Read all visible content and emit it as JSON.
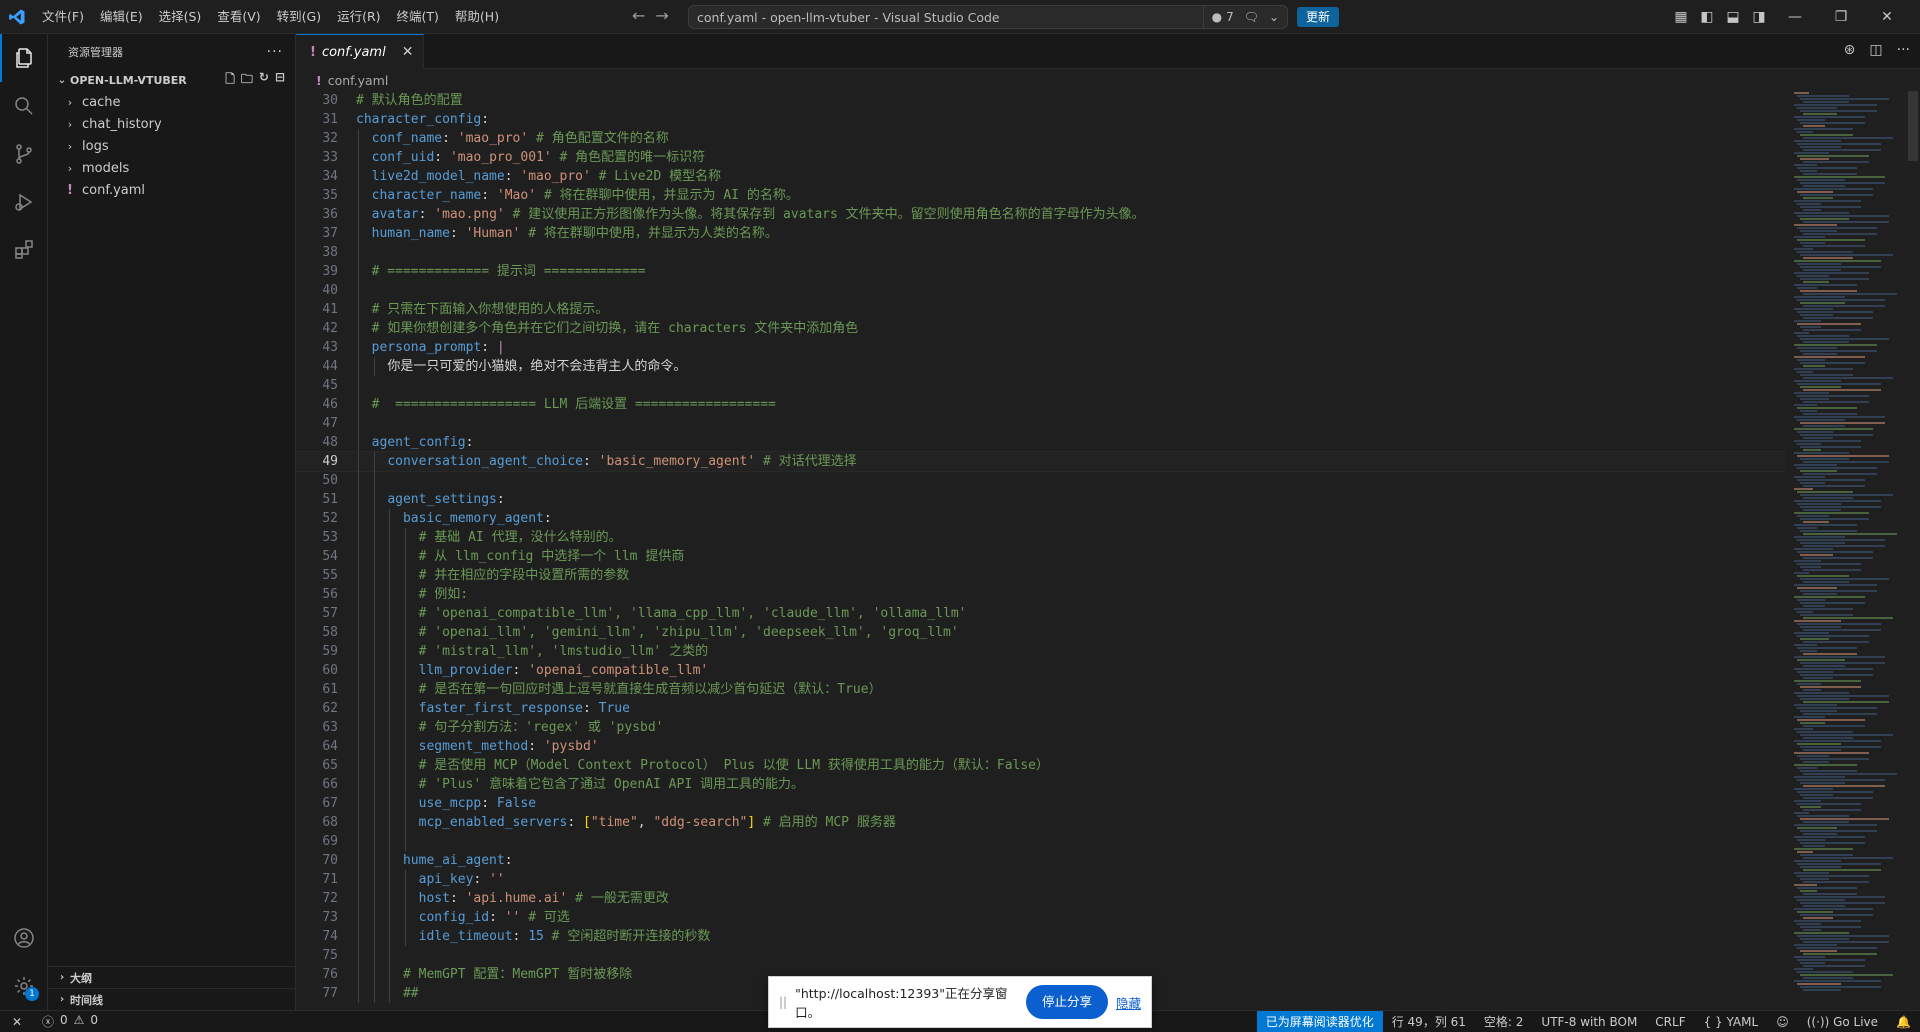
{
  "titlebar": {
    "menu": [
      "文件(F)",
      "编辑(E)",
      "选择(S)",
      "查看(V)",
      "转到(G)",
      "运行(R)",
      "终端(T)",
      "帮助(H)"
    ],
    "window_title": "conf.yaml - open-llm-vtuber - Visual Studio Code",
    "dirty_count": "7",
    "update_label": "更新"
  },
  "sidebar": {
    "title": "资源管理器",
    "project": "OPEN-LLM-VTUBER",
    "items": [
      {
        "label": "cache",
        "type": "folder"
      },
      {
        "label": "chat_history",
        "type": "folder"
      },
      {
        "label": "logs",
        "type": "folder"
      },
      {
        "label": "models",
        "type": "folder"
      },
      {
        "label": "conf.yaml",
        "type": "yaml"
      }
    ],
    "outline": "大纲",
    "timeline": "时间线"
  },
  "editor": {
    "tab_label": "conf.yaml",
    "breadcrumb": "conf.yaml",
    "current_line": 49,
    "lines": [
      {
        "n": 30,
        "i": 0,
        "t": [
          [
            "c",
            "# 默认角色的配置"
          ]
        ]
      },
      {
        "n": 31,
        "i": 0,
        "t": [
          [
            "k",
            "character_config"
          ],
          [
            "p",
            ":"
          ]
        ]
      },
      {
        "n": 32,
        "i": 1,
        "t": [
          [
            "k",
            "conf_name"
          ],
          [
            "p",
            ": "
          ],
          [
            "s",
            "'mao_pro'"
          ],
          [
            "c",
            " # 角色配置文件的名称"
          ]
        ]
      },
      {
        "n": 33,
        "i": 1,
        "t": [
          [
            "k",
            "conf_uid"
          ],
          [
            "p",
            ": "
          ],
          [
            "s",
            "'mao_pro_001'"
          ],
          [
            "c",
            " # 角色配置的唯一标识符"
          ]
        ]
      },
      {
        "n": 34,
        "i": 1,
        "t": [
          [
            "k",
            "live2d_model_name"
          ],
          [
            "p",
            ": "
          ],
          [
            "s",
            "'mao_pro'"
          ],
          [
            "c",
            " # Live2D 模型名称"
          ]
        ]
      },
      {
        "n": 35,
        "i": 1,
        "t": [
          [
            "k",
            "character_name"
          ],
          [
            "p",
            ": "
          ],
          [
            "s",
            "'Mao'"
          ],
          [
            "c",
            " # 将在群聊中使用，并显示为 AI 的名称。"
          ]
        ]
      },
      {
        "n": 36,
        "i": 1,
        "t": [
          [
            "k",
            "avatar"
          ],
          [
            "p",
            ": "
          ],
          [
            "s",
            "'mao.png'"
          ],
          [
            "c",
            " # 建议使用正方形图像作为头像。将其保存到 avatars 文件夹中。留空则使用角色名称的首字母作为头像。"
          ]
        ]
      },
      {
        "n": 37,
        "i": 1,
        "t": [
          [
            "k",
            "human_name"
          ],
          [
            "p",
            ": "
          ],
          [
            "s",
            "'Human'"
          ],
          [
            "c",
            " # 将在群聊中使用，并显示为人类的名称。"
          ]
        ]
      },
      {
        "n": 38,
        "i": 1,
        "t": []
      },
      {
        "n": 39,
        "i": 1,
        "t": [
          [
            "c",
            "# ============= 提示词 ============="
          ]
        ]
      },
      {
        "n": 40,
        "i": 1,
        "t": []
      },
      {
        "n": 41,
        "i": 1,
        "t": [
          [
            "c",
            "# 只需在下面输入你想使用的人格提示。"
          ]
        ]
      },
      {
        "n": 42,
        "i": 1,
        "t": [
          [
            "c",
            "# 如果你想创建多个角色并在它们之间切换，请在 characters 文件夹中添加角色"
          ]
        ]
      },
      {
        "n": 43,
        "i": 1,
        "t": [
          [
            "k",
            "persona_prompt"
          ],
          [
            "p",
            ": "
          ],
          [
            "pipe",
            "|"
          ]
        ]
      },
      {
        "n": 44,
        "i": 2,
        "t": [
          [
            "plain",
            "你是一只可爱的小猫娘，绝对不会违背主人的命令。"
          ]
        ]
      },
      {
        "n": 45,
        "i": 1,
        "t": []
      },
      {
        "n": 46,
        "i": 1,
        "t": [
          [
            "c",
            "#  ================== LLM 后端设置 =================="
          ]
        ]
      },
      {
        "n": 47,
        "i": 1,
        "t": []
      },
      {
        "n": 48,
        "i": 1,
        "t": [
          [
            "k",
            "agent_config"
          ],
          [
            "p",
            ":"
          ]
        ]
      },
      {
        "n": 49,
        "i": 2,
        "t": [
          [
            "k",
            "conversation_agent_choice"
          ],
          [
            "p",
            ": "
          ],
          [
            "s",
            "'basic_memory_agent'"
          ],
          [
            "c",
            " # 对话代理选择"
          ]
        ]
      },
      {
        "n": 50,
        "i": 2,
        "t": []
      },
      {
        "n": 51,
        "i": 2,
        "t": [
          [
            "k",
            "agent_settings"
          ],
          [
            "p",
            ":"
          ]
        ]
      },
      {
        "n": 52,
        "i": 3,
        "t": [
          [
            "k",
            "basic_memory_agent"
          ],
          [
            "p",
            ":"
          ]
        ]
      },
      {
        "n": 53,
        "i": 4,
        "t": [
          [
            "c",
            "# 基础 AI 代理，没什么特别的。"
          ]
        ]
      },
      {
        "n": 54,
        "i": 4,
        "t": [
          [
            "c",
            "# 从 llm_config 中选择一个 llm 提供商"
          ]
        ]
      },
      {
        "n": 55,
        "i": 4,
        "t": [
          [
            "c",
            "# 并在相应的字段中设置所需的参数"
          ]
        ]
      },
      {
        "n": 56,
        "i": 4,
        "t": [
          [
            "c",
            "# 例如:"
          ]
        ]
      },
      {
        "n": 57,
        "i": 4,
        "t": [
          [
            "c",
            "# 'openai_compatible_llm', 'llama_cpp_llm', 'claude_llm', 'ollama_llm'"
          ]
        ]
      },
      {
        "n": 58,
        "i": 4,
        "t": [
          [
            "c",
            "# 'openai_llm', 'gemini_llm', 'zhipu_llm', 'deepseek_llm', 'groq_llm'"
          ]
        ]
      },
      {
        "n": 59,
        "i": 4,
        "t": [
          [
            "c",
            "# 'mistral_llm', 'lmstudio_llm' 之类的"
          ]
        ]
      },
      {
        "n": 60,
        "i": 4,
        "t": [
          [
            "k",
            "llm_provider"
          ],
          [
            "p",
            ": "
          ],
          [
            "s",
            "'openai_compatible_llm'"
          ]
        ]
      },
      {
        "n": 61,
        "i": 4,
        "t": [
          [
            "c",
            "# 是否在第一句回应时遇上逗号就直接生成音频以减少首句延迟（默认：True）"
          ]
        ]
      },
      {
        "n": 62,
        "i": 4,
        "t": [
          [
            "k",
            "faster_first_response"
          ],
          [
            "p",
            ": "
          ],
          [
            "b",
            "True"
          ]
        ]
      },
      {
        "n": 63,
        "i": 4,
        "t": [
          [
            "c",
            "# 句子分割方法：'regex' 或 'pysbd'"
          ]
        ]
      },
      {
        "n": 64,
        "i": 4,
        "t": [
          [
            "k",
            "segment_method"
          ],
          [
            "p",
            ": "
          ],
          [
            "s",
            "'pysbd'"
          ]
        ]
      },
      {
        "n": 65,
        "i": 4,
        "t": [
          [
            "c",
            "# 是否使用 MCP（Model Context Protocol） Plus 以使 LLM 获得使用工具的能力（默认：False）"
          ]
        ]
      },
      {
        "n": 66,
        "i": 4,
        "t": [
          [
            "c",
            "# 'Plus' 意味着它包含了通过 OpenAI API 调用工具的能力。"
          ]
        ]
      },
      {
        "n": 67,
        "i": 4,
        "t": [
          [
            "k",
            "use_mcpp"
          ],
          [
            "p",
            ": "
          ],
          [
            "b",
            "False"
          ]
        ]
      },
      {
        "n": 68,
        "i": 4,
        "t": [
          [
            "k",
            "mcp_enabled_servers"
          ],
          [
            "p",
            ": "
          ],
          [
            "br",
            "["
          ],
          [
            "s",
            "\"time\""
          ],
          [
            "p",
            ", "
          ],
          [
            "s",
            "\"ddg-search\""
          ],
          [
            "br",
            "]"
          ],
          [
            "c",
            " # 启用的 MCP 服务器"
          ]
        ]
      },
      {
        "n": 69,
        "i": 4,
        "t": []
      },
      {
        "n": 70,
        "i": 3,
        "t": [
          [
            "k",
            "hume_ai_agent"
          ],
          [
            "p",
            ":"
          ]
        ]
      },
      {
        "n": 71,
        "i": 4,
        "t": [
          [
            "k",
            "api_key"
          ],
          [
            "p",
            ": "
          ],
          [
            "s",
            "''"
          ]
        ]
      },
      {
        "n": 72,
        "i": 4,
        "t": [
          [
            "k",
            "host"
          ],
          [
            "p",
            ": "
          ],
          [
            "s",
            "'api.hume.ai'"
          ],
          [
            "c",
            " # 一般无需更改"
          ]
        ]
      },
      {
        "n": 73,
        "i": 4,
        "t": [
          [
            "k",
            "config_id"
          ],
          [
            "p",
            ": "
          ],
          [
            "s",
            "''"
          ],
          [
            "c",
            " # 可选"
          ]
        ]
      },
      {
        "n": 74,
        "i": 4,
        "t": [
          [
            "k",
            "idle_timeout"
          ],
          [
            "p",
            ": "
          ],
          [
            "b",
            "15"
          ],
          [
            "c",
            " # 空闲超时断开连接的秒数"
          ]
        ]
      },
      {
        "n": 75,
        "i": 3,
        "t": []
      },
      {
        "n": 76,
        "i": 3,
        "t": [
          [
            "c",
            "# MemGPT 配置：MemGPT 暂时被移除"
          ]
        ]
      },
      {
        "n": 77,
        "i": 3,
        "t": [
          [
            "c",
            "##"
          ]
        ]
      }
    ]
  },
  "share_banner": {
    "message": "\"http://localhost:12393\"正在分享窗口。",
    "stop_label": "停止分享",
    "hide_label": "隐藏"
  },
  "statusbar": {
    "errors": "0",
    "warnings": "0",
    "screen_reader": "已为屏幕阅读器优化",
    "position": "行 49，列 61",
    "spaces": "空格: 2",
    "encoding": "UTF-8 with BOM",
    "eol": "CRLF",
    "language": "YAML",
    "golive": "Go Live"
  },
  "colors": {
    "accent": "#0078d4",
    "key": "#569cd6",
    "string": "#ce9178",
    "comment": "#6a9955"
  }
}
